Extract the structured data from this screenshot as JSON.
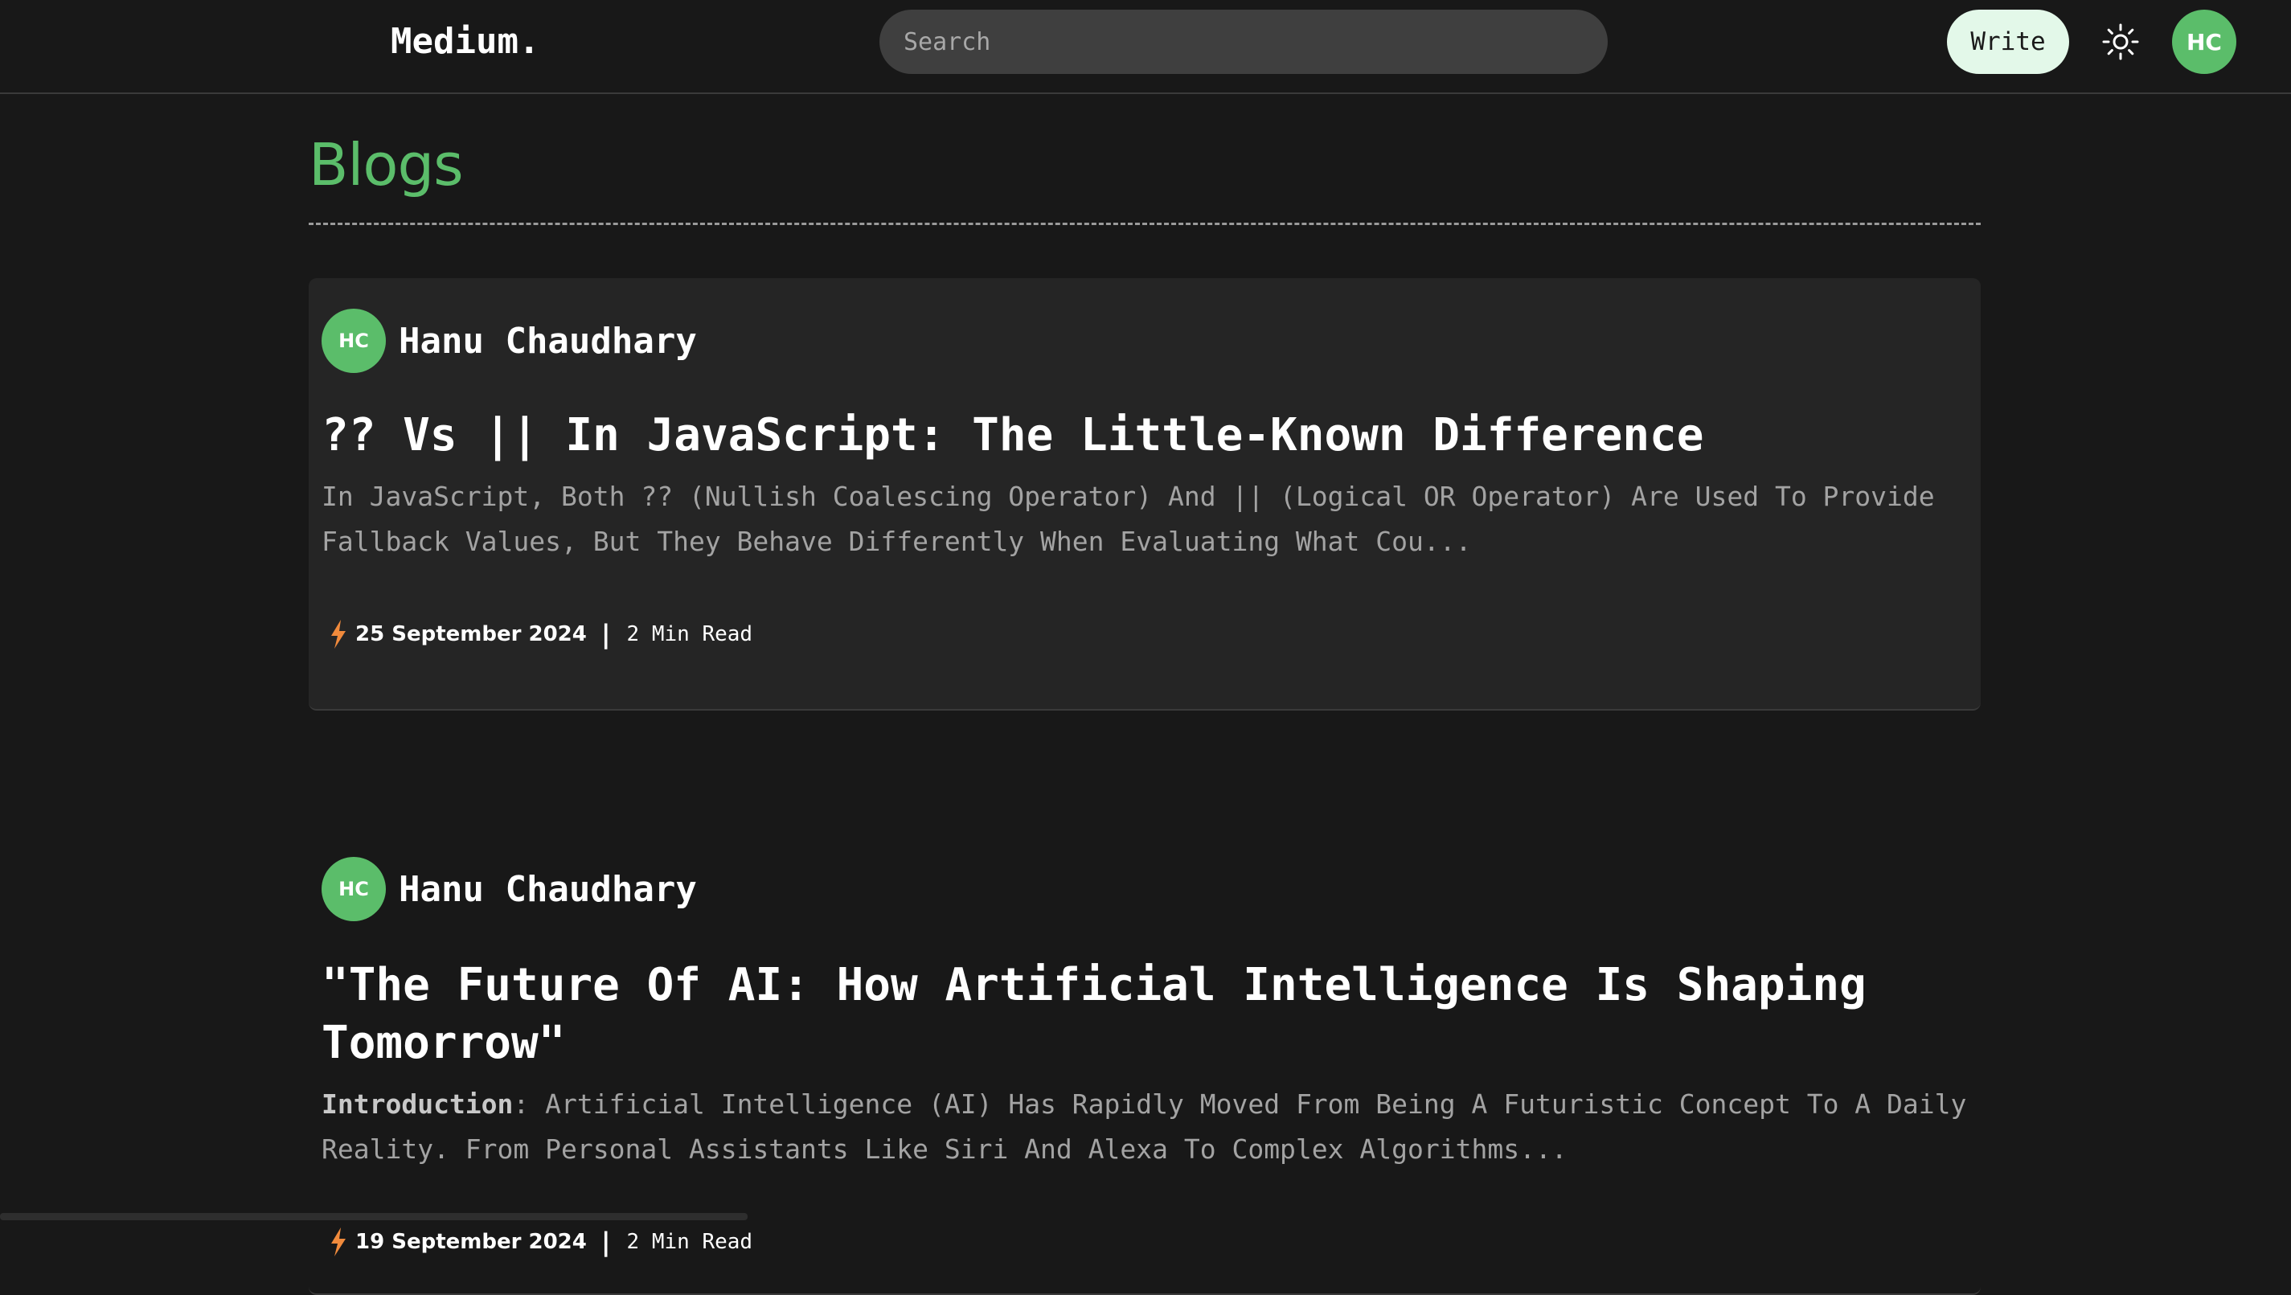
{
  "header": {
    "brand": "Medium.",
    "search_placeholder": "Search",
    "write_label": "Write",
    "theme_icon": "sun-icon",
    "user_initials": "HC"
  },
  "page": {
    "title": "Blogs"
  },
  "colors": {
    "accent": "#5bbd6a",
    "background": "#181818",
    "card": "#252525",
    "bolt": "#f08a3c"
  },
  "posts": [
    {
      "author_initials": "HC",
      "author": "Hanu Chaudhary",
      "title": "?? Vs || In JavaScript: The Little-Known Difference",
      "excerpt_prefix": "",
      "excerpt": "In JavaScript, Both ?? (Nullish Coalescing Operator) And || (Logical OR Operator) Are Used To Provide Fallback Values, But They Behave Differently When Evaluating What Cou...",
      "date": "25 September 2024",
      "separator": "|",
      "read_time": "2 Min Read"
    },
    {
      "author_initials": "HC",
      "author": "Hanu Chaudhary",
      "title": "\"The Future Of AI: How Artificial Intelligence Is Shaping Tomorrow\"",
      "excerpt_prefix": "Introduction",
      "excerpt": ": Artificial Intelligence (AI) Has Rapidly Moved From Being A Futuristic Concept To A Daily Reality. From Personal Assistants Like Siri And Alexa To Complex Algorithms...",
      "date": "19 September 2024",
      "separator": "|",
      "read_time": "2 Min Read"
    }
  ]
}
